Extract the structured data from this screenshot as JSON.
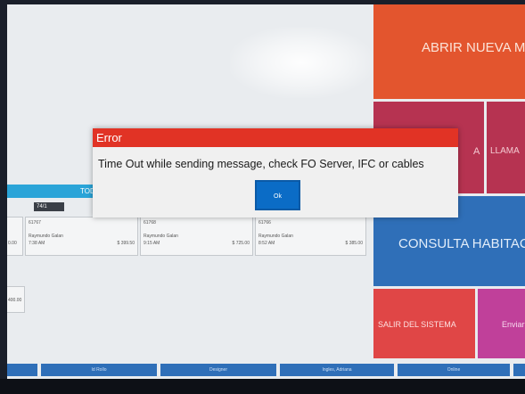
{
  "main": {
    "todo_label": "TOD",
    "active_tab_label": "74/1"
  },
  "tickets": [
    {
      "id": "61767",
      "name": "Raymundo Galan",
      "time": "7:38 AM",
      "amount": "$ 399.50"
    },
    {
      "id": "61768",
      "name": "Raymundo Galan",
      "time": "9:15 AM",
      "amount": "$ 725.00"
    },
    {
      "id": "61766",
      "name": "Raymundo Galan",
      "time": "8:52 AM",
      "amount": "$ 385.00"
    }
  ],
  "partial_cards": {
    "left_amount": "0.00",
    "small_amount": "400.00"
  },
  "tiles": {
    "abrir": "ABRIR NUEVA M",
    "a_fragment": "A",
    "llamar": "LLAMA",
    "consulta": "CONSULTA HABITAC",
    "salir": "SALIR DEL SISTEMA",
    "enviar": "Enviar"
  },
  "bottom_bar": {
    "items": [
      "Id Rollo",
      "Designer",
      "Ingles, Adriana",
      "Online"
    ]
  },
  "dialog": {
    "title": "Error",
    "message": "Time Out while sending message, check FO Server, IFC or cables",
    "ok_label": "Ok"
  },
  "colors": {
    "error_red": "#e13325",
    "ok_blue": "#0b6cc6",
    "tile_orange": "#e3552e",
    "tile_maroon": "#b63351",
    "tile_blue": "#2f6fb8",
    "tile_red": "#e04646",
    "tile_purple": "#c0409a"
  }
}
